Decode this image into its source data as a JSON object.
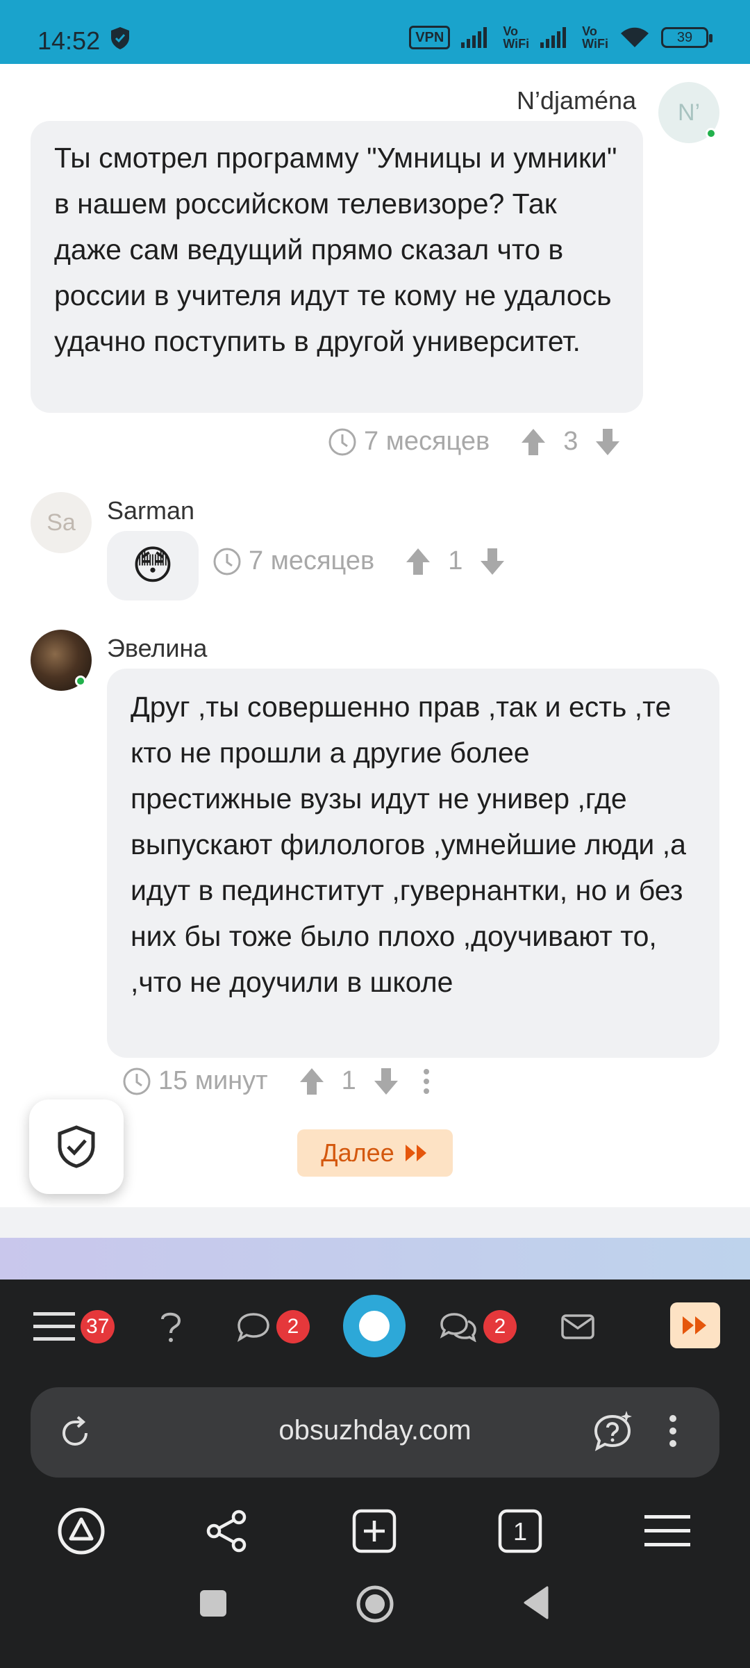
{
  "status_bar": {
    "time": "14:52",
    "vpn_label": "VPN",
    "volte1": [
      "Vo",
      "WiFi"
    ],
    "volte2": [
      "Vo",
      "WiFi"
    ],
    "battery": "39"
  },
  "comments": [
    {
      "author": "N’djaména",
      "avatar_text": "N’",
      "text": "Ты смотрел программу \"Умницы и умники\" в нашем российском телевизоре? Так даже сам ведущий прямо сказал что в россии в учителя идут те кому не удалось удачно поступить в другой университет.",
      "time": "7 месяцев",
      "votes": "3"
    },
    {
      "author": "Sarman",
      "avatar_text": "Sa",
      "text": "😳",
      "time": "7 месяцев",
      "votes": "1"
    },
    {
      "author": "Эвелина",
      "avatar_text": "",
      "text": "Друг ,ты совершенно прав ,так и есть ,те кто не прошли а другие более престижные вузы идут не универ ,где выпускают филологов ,умнейшие люди ,а идут в пединститут ,гувернантки, но и без них бы тоже было плохо ,доучивают то, ,что не доучили в школе",
      "time": "15 минут",
      "votes": "1"
    }
  ],
  "next_button": "Далее",
  "site_nav": {
    "menu_badge": "37",
    "comments_badge": "2",
    "chats_badge": "2"
  },
  "browser": {
    "url": "obsuzhday.com",
    "tab_count": "1"
  },
  "colors": {
    "status_bar": "#1aa3cc",
    "accent": "#2da8d8",
    "badge": "#e5383b",
    "next_bg": "#fde2c4",
    "next_text": "#d4580e"
  }
}
